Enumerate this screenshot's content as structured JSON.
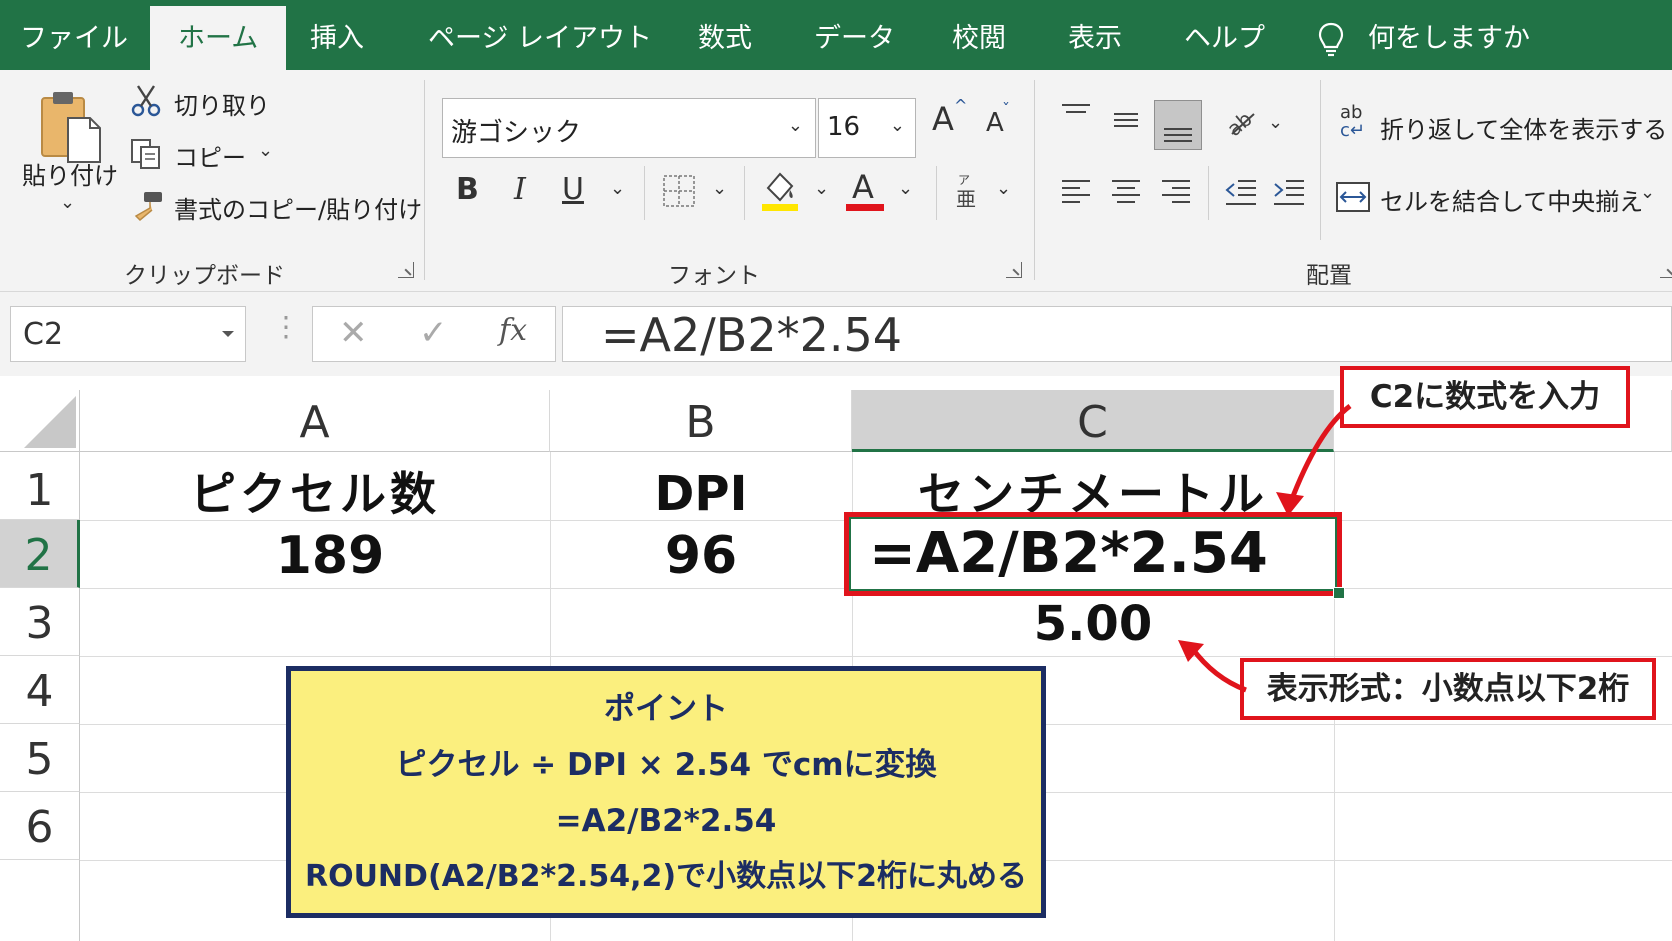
{
  "tabs": [
    {
      "label": "ファイル",
      "active": false
    },
    {
      "label": "ホーム",
      "active": true
    },
    {
      "label": "挿入",
      "active": false
    },
    {
      "label": "ページ レイアウト",
      "active": false
    },
    {
      "label": "数式",
      "active": false
    },
    {
      "label": "データ",
      "active": false
    },
    {
      "label": "校閲",
      "active": false
    },
    {
      "label": "表示",
      "active": false
    },
    {
      "label": "ヘルプ",
      "active": false
    }
  ],
  "tell_me": {
    "label": "何をしますか",
    "icon": "lightbulb-icon"
  },
  "clipboard": {
    "paste_label": "貼り付け",
    "cut_label": "切り取り",
    "copy_label": "コピー",
    "format_painter_label": "書式のコピー/貼り付け",
    "group_label": "クリップボード"
  },
  "font": {
    "font_name": "游ゴシック",
    "font_size": "16",
    "grow_label": "A",
    "shrink_label": "A",
    "bold_label": "B",
    "italic_label": "I",
    "underline_label": "U",
    "font_color_label": "A",
    "group_label": "フォント",
    "highlight_color": "#ffe600",
    "font_color": "#e0141c"
  },
  "alignment": {
    "wrap_label": "折り返して全体を表示する",
    "merge_label": "セルを結合して中央揃え",
    "group_label": "配置",
    "wrap_icon_text": "ab"
  },
  "formula_bar": {
    "name_box": "C2",
    "fx_label": "fx",
    "formula": "=A2/B2*2.54"
  },
  "sheet": {
    "columns": [
      "A",
      "B",
      "C"
    ],
    "selected_column": "C",
    "rows": [
      "1",
      "2",
      "3",
      "4",
      "5",
      "6"
    ],
    "selected_row": "2",
    "cells": {
      "A1": "ピクセル数",
      "B1": "DPI",
      "C1": "センチメートル",
      "A2": "189",
      "B2": "96",
      "C2": "=A2/B2*2.54",
      "C3": "5.00"
    }
  },
  "annotations": {
    "c2_callout": "C2に数式を入力",
    "format_callout": "表示形式：小数点以下2桁",
    "point_title": "ポイント",
    "point_lines": [
      "ピクセル ÷ DPI × 2.54 でcmに変換",
      "=A2/B2*2.54",
      "ROUND(A2/B2*2.54,2)で小数点以下2桁に丸める"
    ],
    "accent_red": "#e0141c",
    "note_yellow": "#fbef7e",
    "note_navy": "#1c2d63"
  },
  "colors": {
    "excel_green": "#217346"
  }
}
